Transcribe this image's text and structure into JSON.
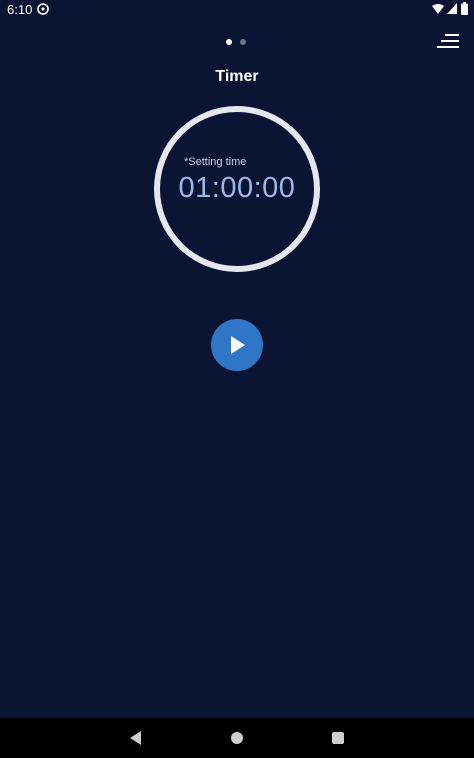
{
  "status_bar": {
    "time": "6:10",
    "icons": [
      "app-notification-icon",
      "wifi-icon",
      "signal-icon",
      "battery-icon"
    ]
  },
  "pager": {
    "pages": 2,
    "active_index": 0
  },
  "header": {
    "title": "Timer",
    "menu_icon": "menu-icon"
  },
  "timer": {
    "setting_label": "*Setting time",
    "value": "01:00:00",
    "ring_color": "#e6e7ee"
  },
  "controls": {
    "play_icon": "play-icon",
    "play_color": "#2f77c6"
  },
  "nav_bar": {
    "icons": [
      "back-icon",
      "home-icon",
      "recents-icon"
    ]
  },
  "colors": {
    "background": "#0b1533",
    "accent": "#2f77c6",
    "time_text": "#9fb7e8"
  }
}
